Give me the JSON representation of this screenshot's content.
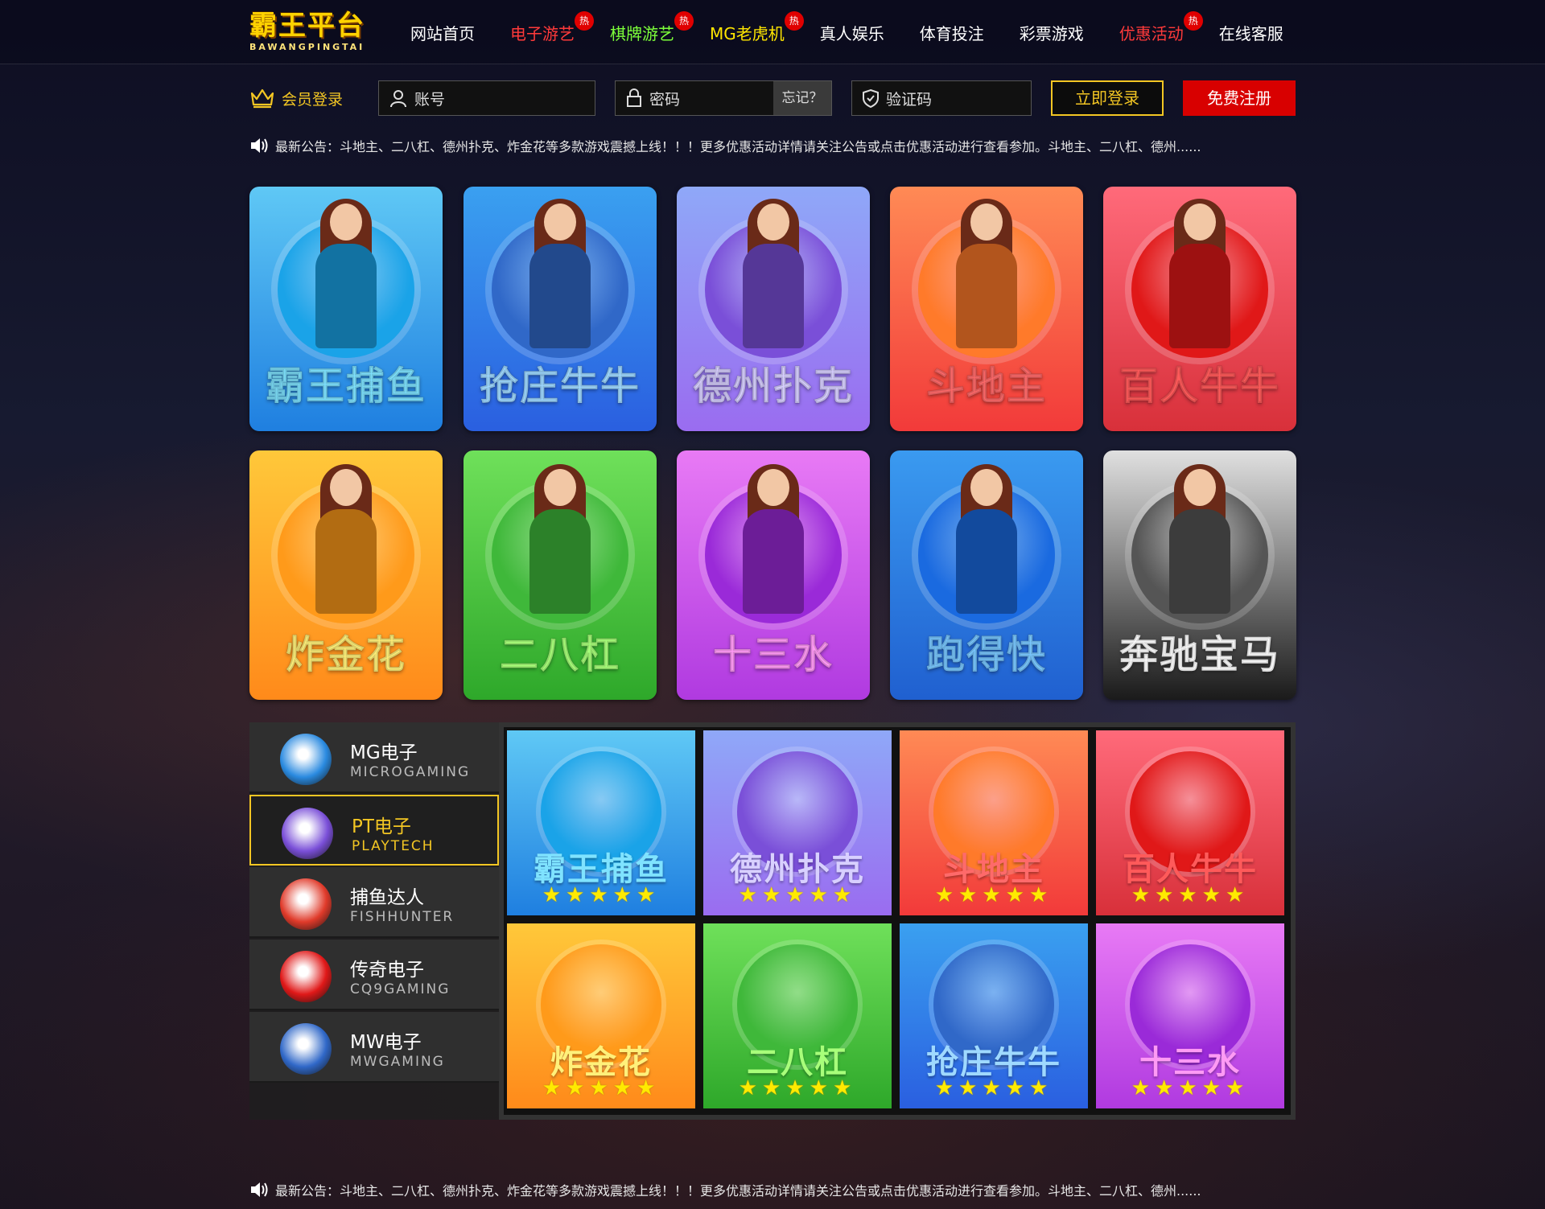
{
  "logo": {
    "main": "霸王平台",
    "sub": "BAWANGPINGTAI"
  },
  "nav": [
    {
      "label": "网站首页",
      "color": "#ffffff",
      "hot": ""
    },
    {
      "label": "电子游艺",
      "color": "#ff3a3a",
      "hot": "热"
    },
    {
      "label": "棋牌游艺",
      "color": "#7dff3a",
      "hot": "热"
    },
    {
      "label": "MG老虎机",
      "color": "#ffe600",
      "hot": "热"
    },
    {
      "label": "真人娱乐",
      "color": "#ffffff",
      "hot": ""
    },
    {
      "label": "体育投注",
      "color": "#ffffff",
      "hot": ""
    },
    {
      "label": "彩票游戏",
      "color": "#ffffff",
      "hot": ""
    },
    {
      "label": "优惠活动",
      "color": "#ff3a3a",
      "hot": "热"
    },
    {
      "label": "在线客服",
      "color": "#ffffff",
      "hot": ""
    }
  ],
  "login": {
    "member_label": "会员登录",
    "account_placeholder": "账号",
    "password_placeholder": "密码",
    "forgot": "忘记？",
    "captcha_placeholder": "验证码",
    "login_button": "立即登录",
    "register_button": "免费注册"
  },
  "notice": "最新公告：斗地主、二八杠、德州扑克、炸金花等多款游戏震撼上线！！！更多优惠活动详情请关注公告或点击优惠活动进行查看参加。斗地主、二八杠、德州......",
  "games": [
    {
      "title": "霸王捕鱼",
      "bg": [
        "#5fc8f5",
        "#1f7fe0"
      ],
      "circle": "#1aa3e8",
      "text": "#7fe3ff"
    },
    {
      "title": "抢庄牛牛",
      "bg": [
        "#3aa0f0",
        "#2a5fe0"
      ],
      "circle": "#3068c8",
      "text": "#9fd9ff"
    },
    {
      "title": "德州扑克",
      "bg": [
        "#8fa8f8",
        "#9a6cf0"
      ],
      "circle": "#7a4fd8",
      "text": "#d8d0ff"
    },
    {
      "title": "斗地主",
      "bg": [
        "#ff8a55",
        "#f23a3a"
      ],
      "circle": "#ff7a2a",
      "text": "#ff6a6a"
    },
    {
      "title": "百人牛牛",
      "bg": [
        "#ff6a7a",
        "#d8303a"
      ],
      "circle": "#e01818",
      "text": "#ff5a5a"
    },
    {
      "title": "炸金花",
      "bg": [
        "#ffc83a",
        "#ff8a1a"
      ],
      "circle": "#ff9a1a",
      "text": "#fff07a"
    },
    {
      "title": "二八杠",
      "bg": [
        "#6fe05a",
        "#2ea82a"
      ],
      "circle": "#3fb83a",
      "text": "#a8ff7a"
    },
    {
      "title": "十三水",
      "bg": [
        "#e87af5",
        "#b03ae0"
      ],
      "circle": "#9a2ad8",
      "text": "#ff9af5"
    },
    {
      "title": "跑得快",
      "bg": [
        "#3a9af0",
        "#2060d0"
      ],
      "circle": "#1a6ae0",
      "text": "#7ac8ff"
    },
    {
      "title": "奔驰宝马",
      "bg": [
        "#e0e0e0",
        "#1a1a1a"
      ],
      "circle": "#555555",
      "text": "#ffffff"
    }
  ],
  "providers": [
    {
      "name": "MG电子",
      "sub": "MICROGAMING",
      "icon": "#2a8ae0",
      "active": false
    },
    {
      "name": "PT电子",
      "sub": "PLAYTECH",
      "icon": "#7a4fd8",
      "active": true
    },
    {
      "name": "捕鱼达人",
      "sub": "FISHHUNTER",
      "icon": "#e03a2a",
      "active": false
    },
    {
      "name": "传奇电子",
      "sub": "CQ9GAMING",
      "icon": "#e01818",
      "active": false
    },
    {
      "name": "MW电子",
      "sub": "MWGAMING",
      "icon": "#3068c8",
      "active": false
    }
  ],
  "tiles": [
    {
      "title": "霸王捕鱼",
      "stars": "★★★★★",
      "bg": [
        "#5fc8f5",
        "#1f7fe0"
      ],
      "circle": "#1aa3e8",
      "text": "#7fe3ff"
    },
    {
      "title": "德州扑克",
      "stars": "★★★★★",
      "bg": [
        "#8fa8f8",
        "#9a6cf0"
      ],
      "circle": "#7a4fd8",
      "text": "#d8d0ff"
    },
    {
      "title": "斗地主",
      "stars": "★★★★★",
      "bg": [
        "#ff8a55",
        "#f23a3a"
      ],
      "circle": "#ff7a2a",
      "text": "#ff6a6a"
    },
    {
      "title": "百人牛牛",
      "stars": "★★★★★",
      "bg": [
        "#ff6a7a",
        "#d8303a"
      ],
      "circle": "#e01818",
      "text": "#ff5a5a"
    },
    {
      "title": "炸金花",
      "stars": "★★★★★",
      "bg": [
        "#ffc83a",
        "#ff8a1a"
      ],
      "circle": "#ff9a1a",
      "text": "#fff07a"
    },
    {
      "title": "二八杠",
      "stars": "★★★★★",
      "bg": [
        "#6fe05a",
        "#2ea82a"
      ],
      "circle": "#3fb83a",
      "text": "#a8ff7a"
    },
    {
      "title": "抢庄牛牛",
      "stars": "★★★★★",
      "bg": [
        "#3aa0f0",
        "#2a5fe0"
      ],
      "circle": "#3068c8",
      "text": "#9fd9ff"
    },
    {
      "title": "十三水",
      "stars": "★★★★★",
      "bg": [
        "#e87af5",
        "#b03ae0"
      ],
      "circle": "#9a2ad8",
      "text": "#ff9af5"
    }
  ],
  "colors": {
    "gold": "#f3c623",
    "red": "#d80000"
  }
}
